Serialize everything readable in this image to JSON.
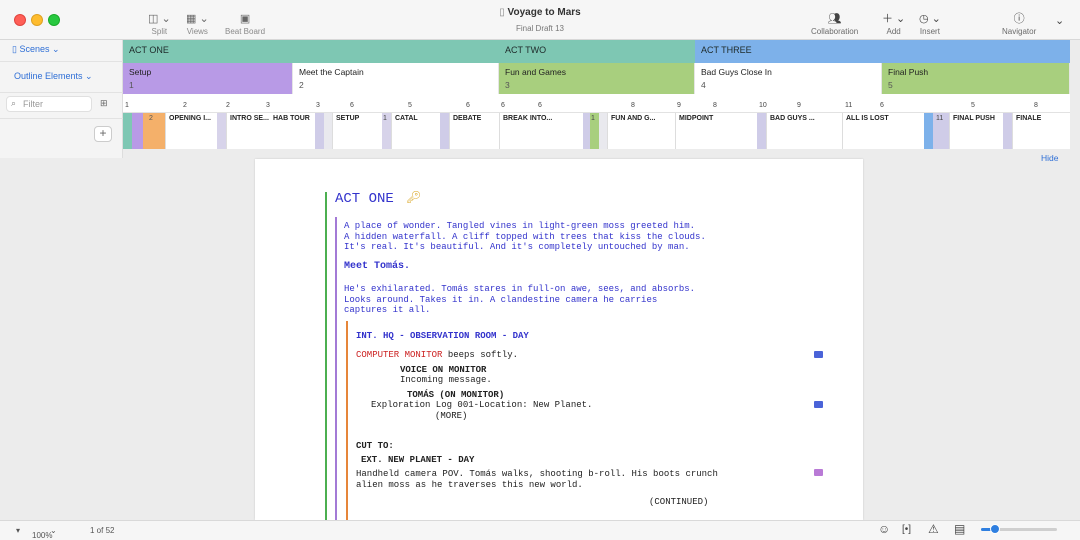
{
  "app": {
    "doc_title": "Voyage to Mars",
    "subtitle": "Final Draft 13"
  },
  "toolbar": {
    "split": "Split",
    "views": "Views",
    "beat_board": "Beat Board",
    "collaboration": "Collaboration",
    "add": "Add",
    "insert": "Insert",
    "navigator": "Navigator"
  },
  "sidebar": {
    "scenes": "Scenes",
    "outline_elements": "Outline Elements",
    "filter_placeholder": "Filter"
  },
  "acts": [
    {
      "label": "ACT ONE",
      "color": "#7ec7b3"
    },
    {
      "label": "ACT TWO",
      "color": "#7ec7b3"
    },
    {
      "label": "ACT THREE",
      "color": "#7db1ea"
    }
  ],
  "sequences": [
    {
      "title": "Setup",
      "num": "1",
      "color": "#b89ae6"
    },
    {
      "title": "Meet the Captain",
      "num": "2",
      "color": "#ffffff"
    },
    {
      "title": "Fun and Games",
      "num": "3",
      "color": "#a8cf7e"
    },
    {
      "title": "Bad Guys Close In",
      "num": "4",
      "color": "#ffffff"
    },
    {
      "title": "Final Push",
      "num": "5",
      "color": "#a8cf7e"
    }
  ],
  "ruler_ticks": [
    "1",
    "2",
    "2",
    "3",
    "3",
    "6",
    "5",
    "6",
    "6",
    "6",
    "8",
    "9",
    "8",
    "10",
    "9",
    "11",
    "6",
    "5",
    "8"
  ],
  "scene_cards": [
    {
      "label": "2"
    },
    {
      "label": "OPENING I..."
    },
    {
      "label": "INTRO SE..."
    },
    {
      "label": "HAB TOUR"
    },
    {
      "label": "SETUP"
    },
    {
      "label": "1"
    },
    {
      "label": "CATAL"
    },
    {
      "label": "DEBATE"
    },
    {
      "label": "BREAK INTO..."
    },
    {
      "label": "1"
    },
    {
      "label": "FUN AND G..."
    },
    {
      "label": "MIDPOINT"
    },
    {
      "label": "BAD GUYS ..."
    },
    {
      "label": "ALL IS LOST"
    },
    {
      "label": "11"
    },
    {
      "label": "FINAL PUSH"
    },
    {
      "label": "FINALE"
    }
  ],
  "hide_link": "Hide",
  "script": {
    "act_heading": "ACT ONE",
    "action1": "A place of wonder. Tangled vines in light-green moss greeted him.\nA hidden waterfall. A cliff topped with trees that kiss the clouds.\nIt's real. It's beautiful. And it's completely untouched by man.",
    "beat": "Meet Tomás.",
    "action2": "He's exhilarated. Tomás stares in full-on awe, sees, and absorbs.\nLooks around. Takes it in. A clandestine camera he carries\ncaptures it all.",
    "scene_heading1": "INT. HQ - OBSERVATION ROOM - DAY",
    "computer_monitor": "COMPUTER MONITOR",
    "beeps": " beeps softly.",
    "char1": "VOICE ON MONITOR",
    "dial1": "Incoming message.",
    "char2": "TOMÁS (ON MONITOR)",
    "dial2": "Exploration Log 001-Location: New Planet.",
    "more": "(MORE)",
    "transition": "CUT TO:",
    "scene_heading2": "EXT. NEW PLANET - DAY",
    "action3": "Handheld camera POV. Tomás walks, shooting b-roll. His boots crunch\nalien moss as he traverses this new world.",
    "continued": "(CONTINUED)"
  },
  "status": {
    "zoom": "100%",
    "pages": "1 of 52"
  },
  "colors": {
    "accent": "#2f6fd6",
    "script_blue": "#3333cc",
    "cue_red": "#cc2222"
  }
}
